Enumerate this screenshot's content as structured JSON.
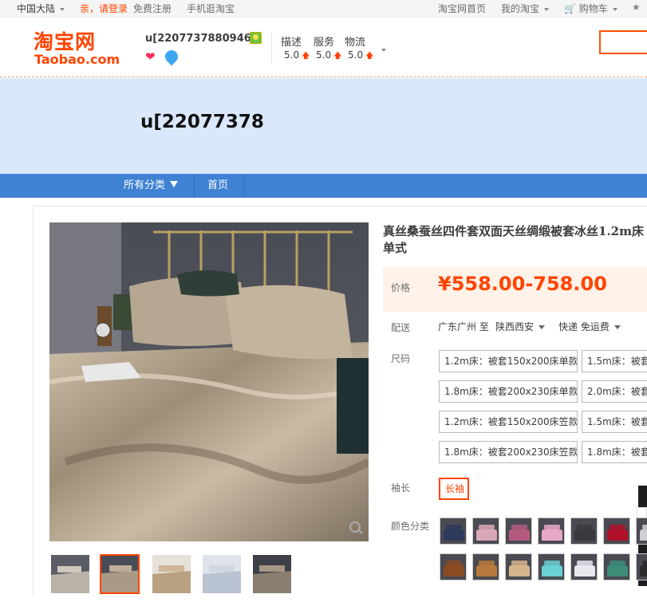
{
  "topnav": {
    "region": "中国大陆",
    "login": "亲，请登录",
    "register": "免费注册",
    "mobile": "手机逛淘宝",
    "home": "淘宝网首页",
    "my_taobao": "我的淘宝",
    "cart": "购物车"
  },
  "header": {
    "logo_cn": "淘宝网",
    "logo_en": "Taobao.com",
    "shop_name": "u[2207737880946]",
    "ratings": [
      {
        "label": "描述",
        "value": "5.0"
      },
      {
        "label": "服务",
        "value": "5.0"
      },
      {
        "label": "物流",
        "value": "5.0"
      }
    ]
  },
  "banner": {
    "title": "u[22077378"
  },
  "shopnav": {
    "all_categories": "所有分类",
    "home": "首页"
  },
  "product": {
    "title": "真丝桑蚕丝四件套双面天丝绸缎被套冰丝1.2m床单式",
    "price_label": "价格",
    "price": "¥558.00-758.00",
    "delivery_label": "配送",
    "delivery_from": "广东广州 至",
    "delivery_to": "陕西西安",
    "delivery_method": "快递 免运费",
    "size_label": "尺码",
    "sizes": [
      "1.2m床：被套150x200床单款",
      "1.5m床：被套",
      "1.8m床：被套200x230床单款",
      "2.0m床：被套",
      "1.2m床：被套150x200床笠款",
      "1.5m床：被套",
      "1.8m床：被套200x230床笠款",
      "1.8m床：被套"
    ],
    "sleeve_label": "袖长",
    "sleeve_option": "长袖",
    "color_label": "颜色分类",
    "swatch_colors": [
      [
        "#2e3a5c",
        "#d9a8b8",
        "#b45a7e",
        "#e8a9c8",
        "#3a3a3e",
        "#b0102a",
        "#cfcfd4"
      ],
      [
        "#8a4a22",
        "#b87a3c",
        "#d6b48c",
        "#6ad0d6",
        "#e8e8ee",
        "#3c8c78",
        "#2b2b2b"
      ]
    ]
  }
}
